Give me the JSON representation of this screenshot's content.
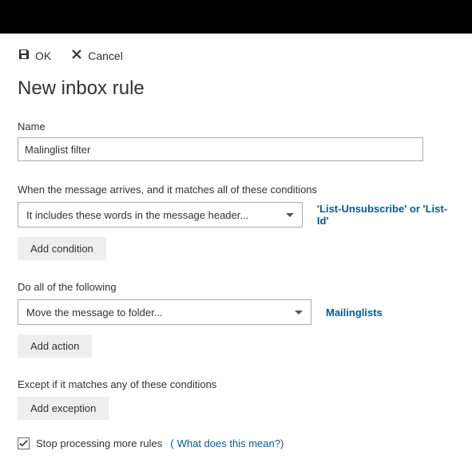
{
  "toolbar": {
    "ok_label": "OK",
    "cancel_label": "Cancel"
  },
  "page_title": "New inbox rule",
  "name": {
    "label": "Name",
    "value": "Malinglist filter"
  },
  "conditions": {
    "section_label": "When the message arrives, and it matches all of these conditions",
    "dropdown_value": "It includes these words in the message header...",
    "link_value": "'List-Unsubscribe' or 'List-Id'",
    "add_button": "Add condition"
  },
  "actions": {
    "section_label": "Do all of the following",
    "dropdown_value": "Move the message to folder...",
    "link_value": "Mailinglists",
    "add_button": "Add action"
  },
  "exceptions": {
    "section_label": "Except if it matches any of these conditions",
    "add_button": "Add exception"
  },
  "stop_processing": {
    "checked": true,
    "label": "Stop processing more rules",
    "help_link": "What does this mean?"
  }
}
